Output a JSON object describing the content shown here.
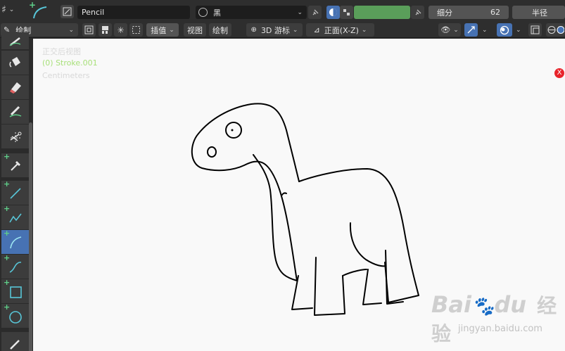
{
  "header": {
    "material_name": "Pencil",
    "color_name": "黑",
    "strength_label": "细分",
    "strength_value": "62",
    "radius_label": "半径",
    "accent_color": "#5a9e5a"
  },
  "header2": {
    "mode_label": "绘制",
    "interpolate_label": "插值",
    "view_label": "视图",
    "draw_label": "绘制",
    "cursor_label": "3D 游标",
    "plane_label": "正面(X-Z)"
  },
  "viewport": {
    "view_name": "正交后视图",
    "object_name": "(0) Stroke.001",
    "units": "Centimeters",
    "close_glyph": "X"
  },
  "watermark": {
    "brand_main": "Bai",
    "brand_mid": "du",
    "brand_cn": "经验",
    "url": "jingyan.baidu.com"
  },
  "tools": [
    {
      "name": "draw-tool",
      "icon": "pencil"
    },
    {
      "name": "fill-tool",
      "icon": "bucket"
    },
    {
      "name": "erase-tool",
      "icon": "eraser"
    },
    {
      "name": "tint-tool",
      "icon": "brush"
    },
    {
      "name": "cutter-tool",
      "icon": "scissors"
    },
    {
      "name": "eyedropper-tool",
      "icon": "eyedropper"
    },
    {
      "name": "line-tool",
      "icon": "line"
    },
    {
      "name": "polyline-tool",
      "icon": "polyline"
    },
    {
      "name": "arc-tool",
      "icon": "arc"
    },
    {
      "name": "curve-tool",
      "icon": "curve"
    },
    {
      "name": "box-tool",
      "icon": "box"
    },
    {
      "name": "circle-tool",
      "icon": "circle"
    },
    {
      "name": "annotate-tool",
      "icon": "annotate"
    }
  ]
}
